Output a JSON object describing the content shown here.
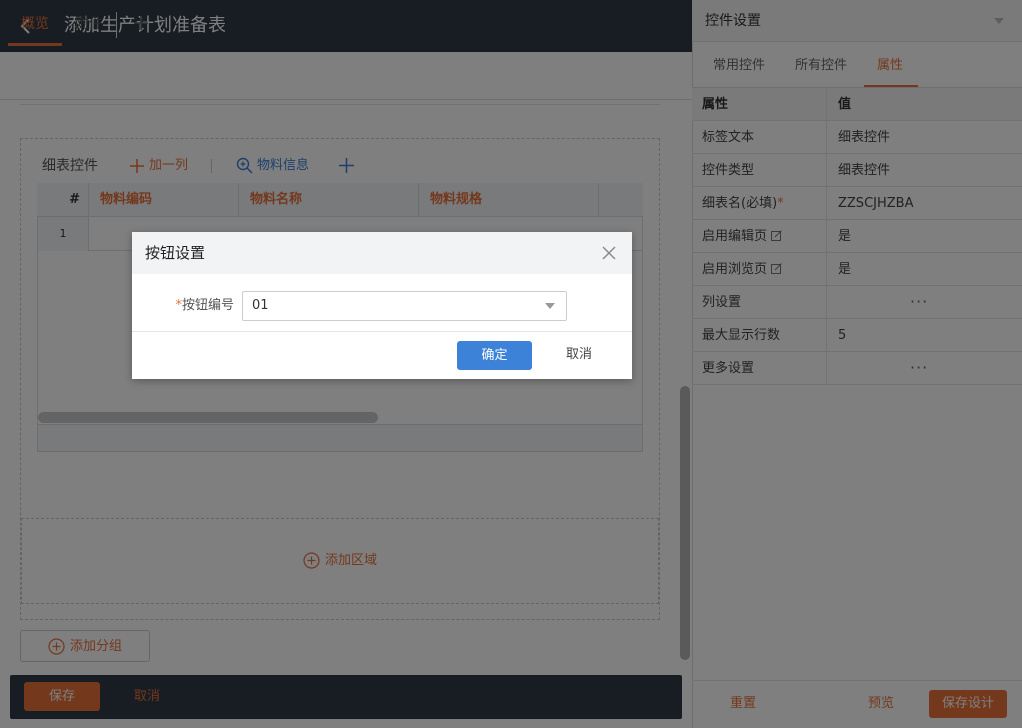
{
  "app": {
    "page_title": "添加生产计划准备表",
    "tabs": {
      "overview": "概览",
      "attachment": "附件"
    }
  },
  "detail": {
    "label": "细表控件",
    "add_column": "加一列",
    "material_info": "物料信息",
    "columns": {
      "num": "#",
      "code": "物料编码",
      "name": "物料名称",
      "spec": "物料规格"
    },
    "rows": [
      {
        "num": "1"
      }
    ],
    "add_region": "添加区域",
    "add_group": "添加分组"
  },
  "bottom_bar": {
    "save": "保存",
    "cancel": "取消"
  },
  "right_panel": {
    "title": "控件设置",
    "tabs": {
      "common": "常用控件",
      "all": "所有控件",
      "props": "属性"
    },
    "table_header": {
      "key": "属性",
      "value": "值"
    },
    "props": [
      {
        "key": "标签文本",
        "value": "细表控件"
      },
      {
        "key": "控件类型",
        "value": "细表控件"
      },
      {
        "key": "细表名(必填)",
        "required_mark": "*",
        "value": "ZZSCJHZBA"
      },
      {
        "key": "启用编辑页",
        "value": "是"
      },
      {
        "key": "启用浏览页",
        "value": "是"
      },
      {
        "key": "列设置",
        "value": "···"
      },
      {
        "key": "最大显示行数",
        "value": "5"
      },
      {
        "key": "更多设置",
        "value": "···"
      }
    ],
    "footer": {
      "reset": "重置",
      "preview": "预览",
      "save_design": "保存设计"
    }
  },
  "dialog": {
    "title": "按钮设置",
    "field_required_mark": "*",
    "field_label": "按钮编号",
    "field_value": "01",
    "ok": "确定",
    "cancel": "取消"
  },
  "colors": {
    "accent": "#e8713a",
    "primary": "#3c82d8",
    "header_dark": "#2f3a45"
  }
}
